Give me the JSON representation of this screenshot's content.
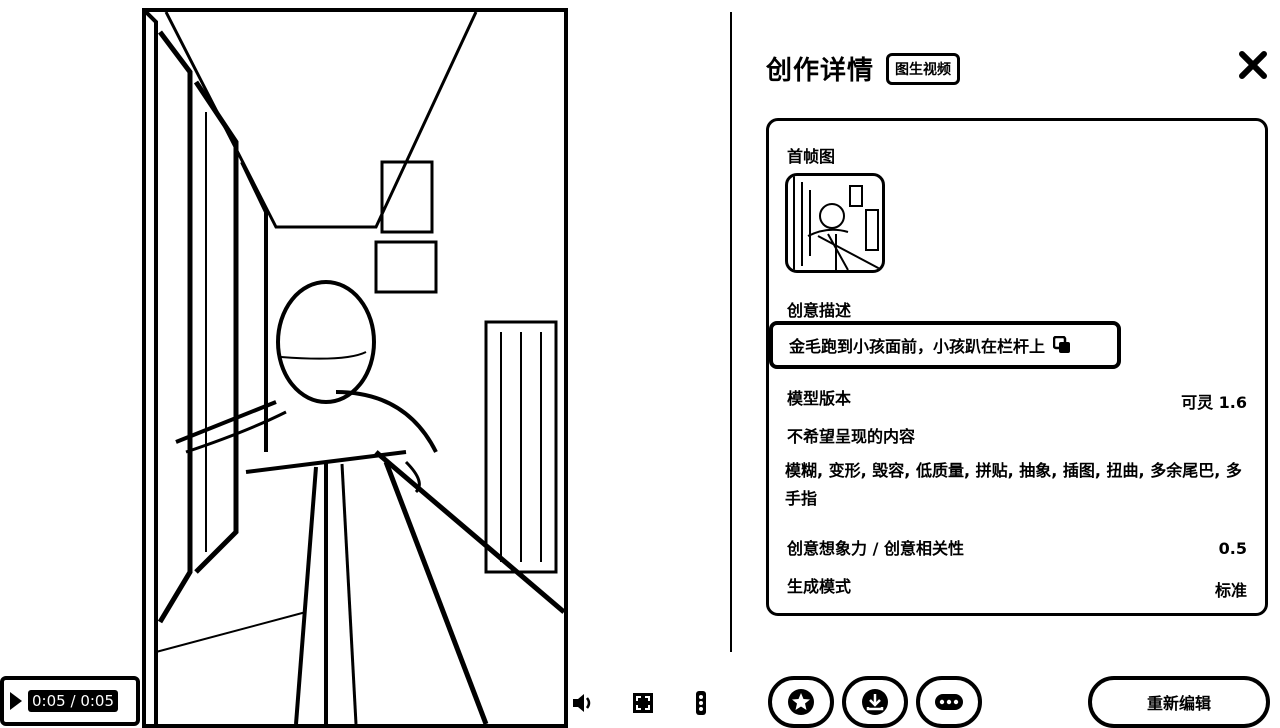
{
  "player": {
    "current_time": "0:05",
    "separator": "/",
    "duration": "0:05"
  },
  "panel": {
    "title": "创作详情",
    "type_badge": "图生视频"
  },
  "details": {
    "first_frame_label": "首帧图",
    "prompt_label": "创意描述",
    "prompt_text": "金毛跑到小孩面前，小孩趴在栏杆上",
    "model_label": "模型版本",
    "model_value": "可灵 1.6",
    "negative_label": "不希望呈现的内容",
    "negative_text": "模糊, 变形, 毁容, 低质量, 拼贴, 抽象, 插图, 扭曲, 多余尾巴, 多手指",
    "creativity_label": "创意想象力 / 创意相关性",
    "creativity_value": "0.5",
    "mode_label": "生成模式",
    "mode_value": "标准"
  },
  "actions": {
    "reedit_label": "重新编辑"
  },
  "icons": {
    "close": "close-icon",
    "copy": "copy-icon",
    "volume": "volume-icon",
    "fullscreen": "fullscreen-icon",
    "more_vertical": "more-vertical-icon",
    "favorite": "star-icon",
    "download": "download-icon",
    "more": "more-horizontal-icon"
  }
}
